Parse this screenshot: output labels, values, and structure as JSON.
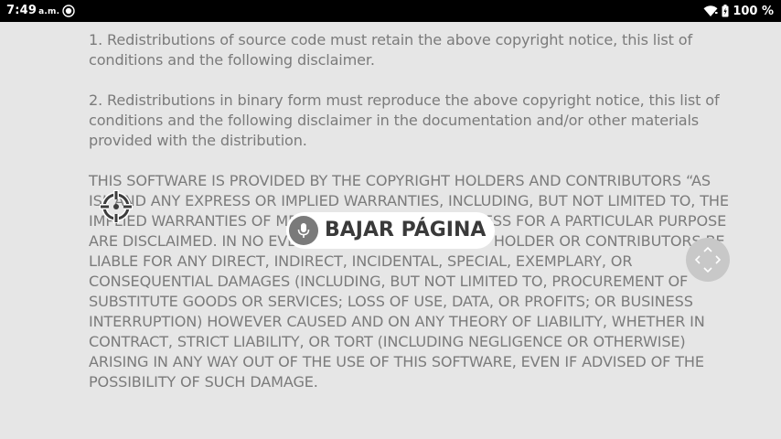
{
  "status_bar": {
    "time": "7:49",
    "ampm": "a.m.",
    "notification_icon": "recording-icon",
    "wifi_icon": "wifi-icon",
    "battery_icon": "battery-icon",
    "battery_percent": "100 %"
  },
  "license": {
    "paragraphs": [
      "1. Redistributions of source code must retain the above copyright notice, this list of conditions and the following disclaimer.",
      "2. Redistributions in binary form must reproduce the above copyright notice, this list of conditions and the following disclaimer in the documentation and/or other materials provided with the distribution.",
      "THIS SOFTWARE IS PROVIDED BY THE COPYRIGHT HOLDERS AND CONTRIBUTORS “AS IS” AND ANY EXPRESS OR IMPLIED WARRANTIES, INCLUDING, BUT NOT LIMITED TO, THE IMPLIED WARRANTIES OF MERCHANTABILITY AND FITNESS FOR A PARTICULAR PURPOSE ARE DISCLAIMED. IN NO EVENT SHALL THE COPYRIGHT HOLDER OR CONTRIBUTORS BE LIABLE FOR ANY DIRECT, INDIRECT, INCIDENTAL, SPECIAL, EXEMPLARY, OR CONSEQUENTIAL DAMAGES (INCLUDING, BUT NOT LIMITED TO, PROCUREMENT OF SUBSTITUTE GOODS OR SERVICES; LOSS OF USE, DATA, OR PROFITS; OR BUSINESS INTERRUPTION) HOWEVER CAUSED AND ON ANY THEORY OF LIABILITY, WHETHER IN CONTRACT, STRICT LIABILITY, OR TORT (INCLUDING NEGLIGENCE OR OTHERWISE) ARISING IN ANY WAY OUT OF THE USE OF THIS SOFTWARE, EVEN IF ADVISED OF THE POSSIBILITY OF SUCH DAMAGE."
    ]
  },
  "overlay": {
    "crosshair_icon": "crosshair-icon",
    "voice_command": {
      "icon": "microphone-icon",
      "label": "BAJAR PÁGINA"
    },
    "scroll_pad_icon": "directional-pad-icon"
  },
  "colors": {
    "background": "#e6e6e6",
    "text": "#7b7b7b",
    "status_bar": "#000000",
    "pill": "#ffffff",
    "pill_text": "#3a3a3a"
  }
}
